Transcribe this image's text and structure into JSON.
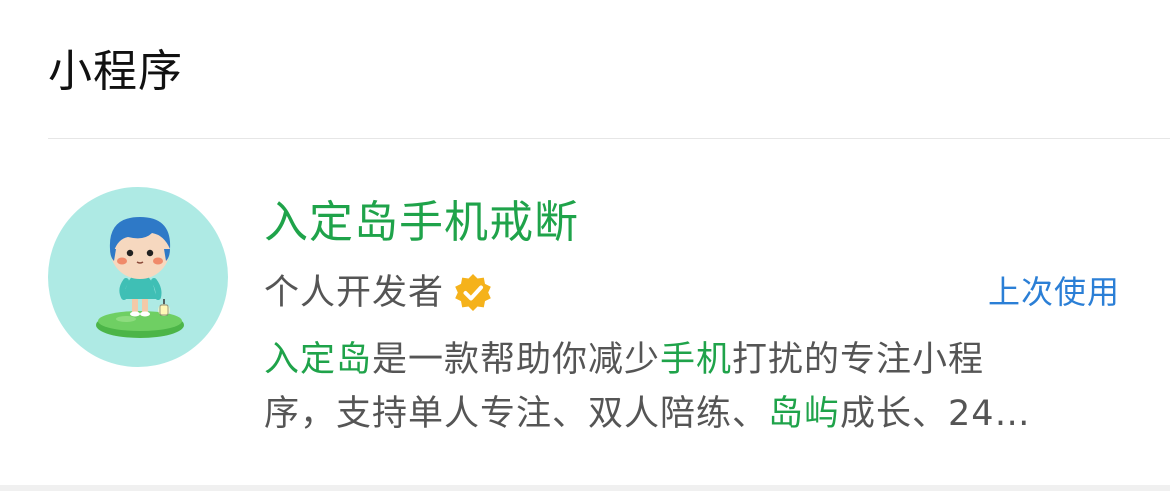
{
  "section": {
    "title": "小程序"
  },
  "result": {
    "name": "入定岛手机戒断",
    "developer": "个人开发者",
    "recent_label": "上次使用",
    "description": {
      "line1": {
        "p1": "入定岛",
        "p2": "是一款帮助你减少",
        "p3": "手机",
        "p4": "打扰的专注小程"
      },
      "line2": {
        "p1": "序，支持单人专注、双人陪练、",
        "p2": "岛屿",
        "p3": "成长、24…"
      }
    },
    "icons": {
      "avatar": "cartoon-boy-on-island-avatar",
      "verified": "verified-badge-icon"
    },
    "colors": {
      "highlight": "#1fa34a",
      "link": "#2b7fd6",
      "badge": "#f5b21b",
      "avatar_bg": "#aeeae4"
    }
  }
}
